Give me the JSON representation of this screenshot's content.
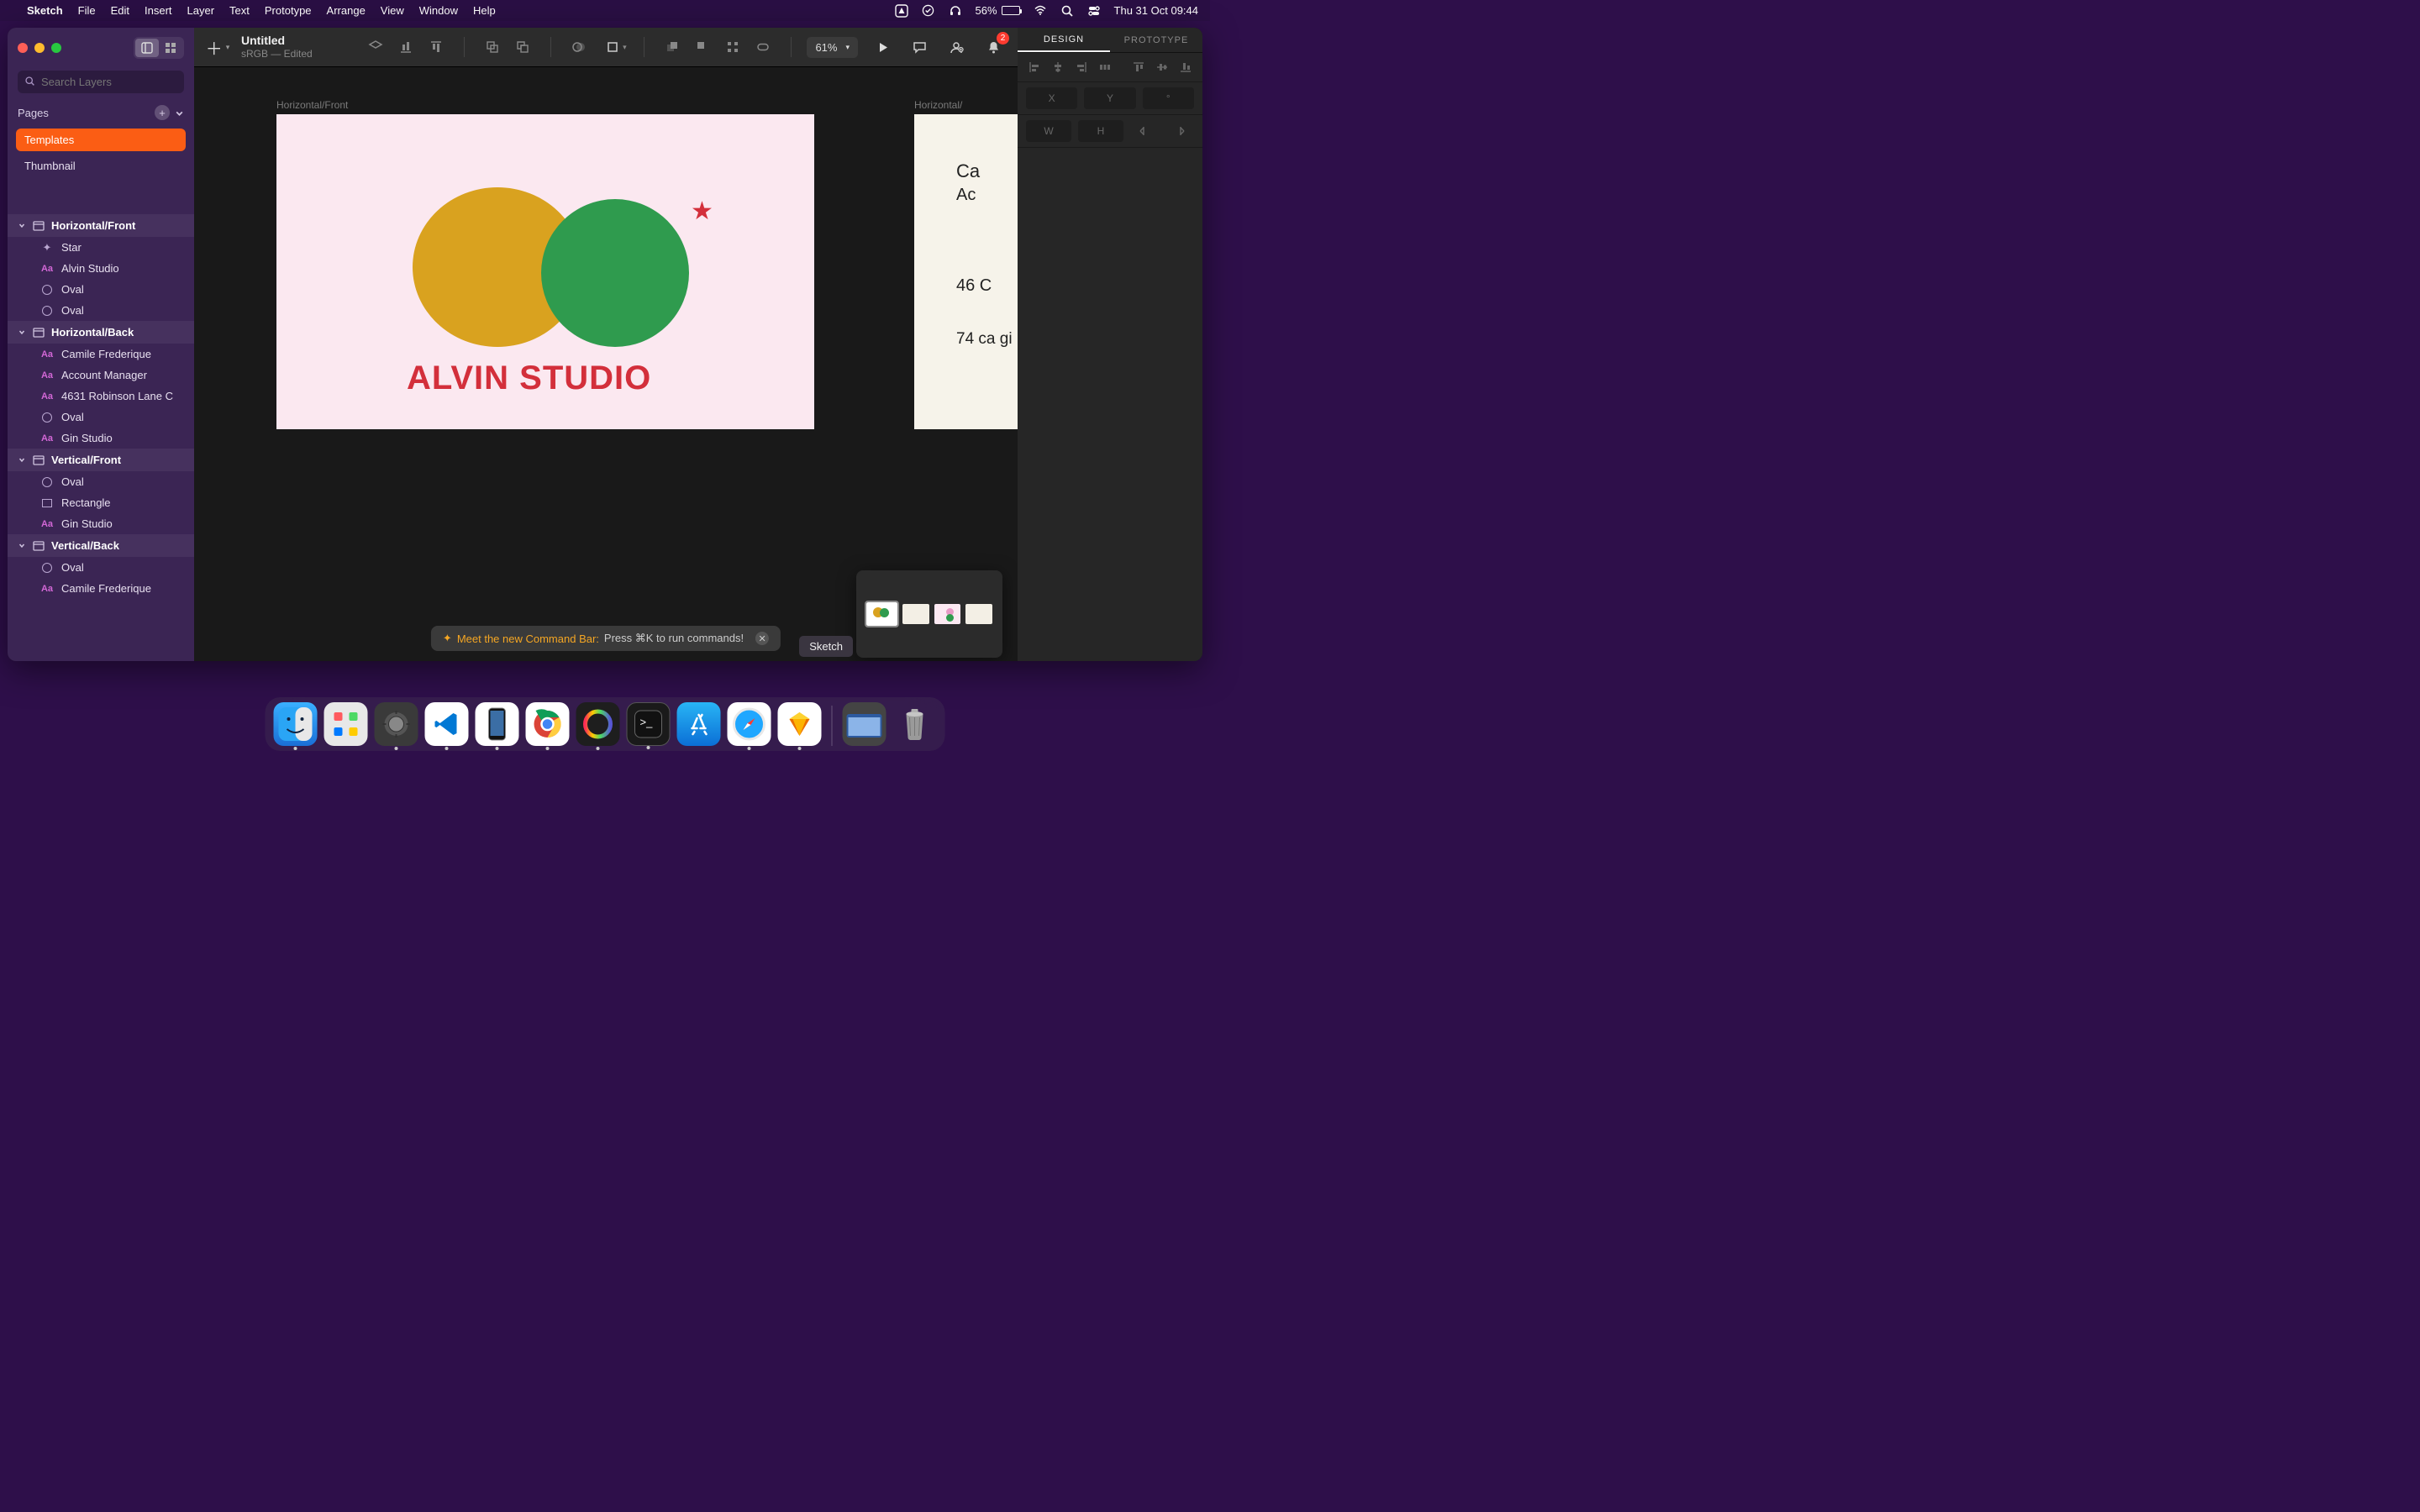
{
  "menubar": {
    "app": "Sketch",
    "items": [
      "File",
      "Edit",
      "Insert",
      "Layer",
      "Text",
      "Prototype",
      "Arrange",
      "View",
      "Window",
      "Help"
    ],
    "battery": "56%",
    "clock": "Thu 31 Oct  09:44"
  },
  "document": {
    "title": "Untitled",
    "subtitle": "sRGB — Edited",
    "zoom": "61%"
  },
  "search": {
    "placeholder": "Search Layers"
  },
  "pages": {
    "header": "Pages",
    "items": [
      "Templates",
      "Thumbnail"
    ],
    "active": 0
  },
  "layers": [
    {
      "group": "Horizontal/Front",
      "items": [
        {
          "type": "star",
          "name": "Star"
        },
        {
          "type": "text",
          "name": "Alvin Studio"
        },
        {
          "type": "oval",
          "name": "Oval"
        },
        {
          "type": "oval",
          "name": "Oval"
        }
      ]
    },
    {
      "group": "Horizontal/Back",
      "items": [
        {
          "type": "text",
          "name": "Camile Frederique"
        },
        {
          "type": "text",
          "name": "Account Manager"
        },
        {
          "type": "text",
          "name": "4631 Robinson Lane C"
        },
        {
          "type": "oval",
          "name": "Oval"
        },
        {
          "type": "text",
          "name": "Gin Studio"
        }
      ]
    },
    {
      "group": "Vertical/Front",
      "items": [
        {
          "type": "oval",
          "name": "Oval"
        },
        {
          "type": "rect",
          "name": "Rectangle"
        },
        {
          "type": "text",
          "name": "Gin Studio"
        }
      ]
    },
    {
      "group": "Vertical/Back",
      "items": [
        {
          "type": "oval",
          "name": "Oval"
        },
        {
          "type": "text",
          "name": "Camile Frederique"
        }
      ]
    }
  ],
  "canvas": {
    "artboards": [
      {
        "label": "Horizontal/Front",
        "brand": "ALVIN STUDIO"
      },
      {
        "label": "Horizontal/",
        "lines": {
          "name": "Ca",
          "role": "Ac",
          "addr": "46\nC",
          "contact": "74\nca\ngi"
        }
      }
    ]
  },
  "commandbar": {
    "highlight": "Meet the new Command Bar:",
    "rest": "Press ⌘K to run commands!"
  },
  "inspector": {
    "tabs": [
      "DESIGN",
      "PROTOTYPE"
    ],
    "active": 0,
    "props": {
      "x": "X",
      "y": "Y",
      "deg": "°",
      "w": "W",
      "h": "H"
    }
  },
  "notif_count": "2",
  "dock": {
    "tooltip": "Sketch",
    "apps": [
      "finder",
      "launchpad",
      "settings",
      "vscode",
      "simulator",
      "chrome",
      "figma",
      "terminal",
      "appstore",
      "safari",
      "sketch"
    ],
    "right": [
      "folder",
      "trash"
    ]
  }
}
